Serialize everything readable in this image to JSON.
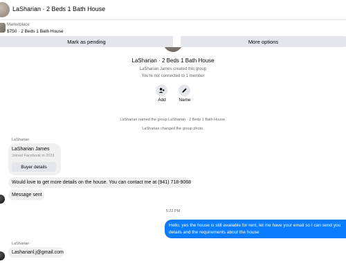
{
  "header": {
    "title": "LaSharian · 2 Beds 1 Bath House"
  },
  "listing": {
    "source": "Marketplace",
    "price_title": "$750 · 2 Beds 1 Bath House"
  },
  "actions": {
    "pending_label": "Mark as pending",
    "options_label": "More options"
  },
  "group": {
    "name": "LaSharian · 2 Beds 1 Bath House",
    "created": "LaSharian James created this group",
    "connection": "You're not connected to 1 member",
    "add_label": "Add",
    "name_label": "Name"
  },
  "system_messages": [
    "LaSharian named the group LaSharian · 2 Beds 1 Bath House.",
    "LaSharian changed the group photo."
  ],
  "thread": {
    "sender_1": "LaSharian",
    "profile_card": {
      "name": "LaSharian James",
      "joined": "Joined Facebook in 2023",
      "button": "Buyer details"
    },
    "msg_1": "Would love to get more details on the house. You can contact me at (941) 718-9068",
    "msg_2": "Message sent",
    "timestamp": "5:22 PM",
    "msg_out": "Hello, yes the house is still available for rent, let me have your email so I can send you details and the requirements about the house",
    "sender_2": "LaSharian",
    "msg_3": "Lasharianl.j@gmail.com"
  },
  "colors": {
    "outgoing_bubble": "#0a7cff",
    "incoming_bubble": "#f0f0f0",
    "button_bg": "#e4e6eb"
  },
  "icons": {
    "add": "add-person-icon",
    "name": "pencil-icon"
  }
}
